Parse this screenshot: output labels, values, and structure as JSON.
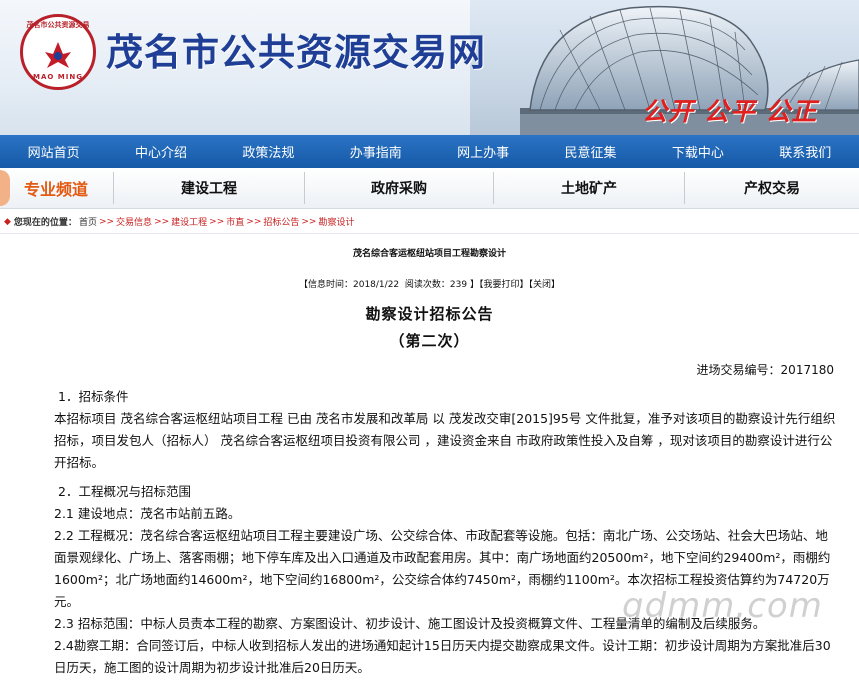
{
  "header": {
    "site_title": "茂名市公共资源交易网",
    "slogan": "公开 公平 公正",
    "logo": {
      "ring_text": "茂名市公共资源交易",
      "bottom_text": "MAO MING"
    }
  },
  "main_nav": [
    "网站首页",
    "中心介绍",
    "政策法规",
    "办事指南",
    "网上办事",
    "民意征集",
    "下载中心",
    "联系我们"
  ],
  "channel": {
    "label": "专业频道",
    "tabs": [
      "建设工程",
      "政府采购",
      "土地矿产",
      "产权交易"
    ]
  },
  "breadcrumb": {
    "label": "您现在的位置：",
    "items": [
      "首页",
      "交易信息",
      "建设工程",
      "市直",
      "招标公告",
      "勘察设计"
    ],
    "separator": ">>"
  },
  "article": {
    "title": "茂名综合客运枢纽站项目工程勘察设计",
    "meta": {
      "time_label": "【信息时间：",
      "time_value": "2018/1/22",
      "views_label": "阅读次数：",
      "views_value": "239",
      "close_bracket": "】",
      "print": "【我要打印】",
      "close": "【关闭】"
    },
    "doc_title": "勘察设计招标公告",
    "doc_subtitle": "（第二次）",
    "doc_number": "进场交易编号：2017180",
    "paragraphs": [
      "1．招标条件",
      "本招标项目 茂名综合客运枢纽站项目工程 已由 茂名市发展和改革局 以 茂发改交审[2015]95号 文件批复，准予对该项目的勘察设计先行组织招标，项目发包人（招标人） 茂名综合客运枢纽项目投资有限公司 ，建设资金来自 市政府政策性投入及自筹 ，现对该项目的勘察设计进行公开招标。",
      "2．工程概况与招标范围",
      "2.1 建设地点：茂名市站前五路。",
      "2.2 工程概况：茂名综合客运枢纽站项目工程主要建设广场、公交综合体、市政配套等设施。包括：南北广场、公交场站、社会大巴场站、地面景观绿化、广场上、落客雨棚；地下停车库及出入口通道及市政配套用房。其中：南广场地面约20500m²，地下空间约29400m²，雨棚约1600m²；北广场地面约14600m²，地下空间约16800m²，公交综合体约7450m²，雨棚约1100m²。本次招标工程投资估算约为74720万元。",
      "2.3 招标范围：中标人员责本工程的勘察、方案图设计、初步设计、施工图设计及投资概算文件、工程量清单的编制及后续服务。",
      "2.4勘察工期：合同签订后，中标人收到招标人发出的进场通知起计15日历天内提交勘察成果文件。设计工期：初步设计周期为方案批准后30日历天，施工图的设计周期为初步设计批准后20日历天。"
    ]
  },
  "watermark": "gdmm.com",
  "colors": {
    "nav_blue": "#165aa8",
    "title_blue": "#1f3f96",
    "slogan_red": "#e0201e",
    "channel_orange": "#e35a13",
    "breadcrumb_red": "#c92020"
  }
}
